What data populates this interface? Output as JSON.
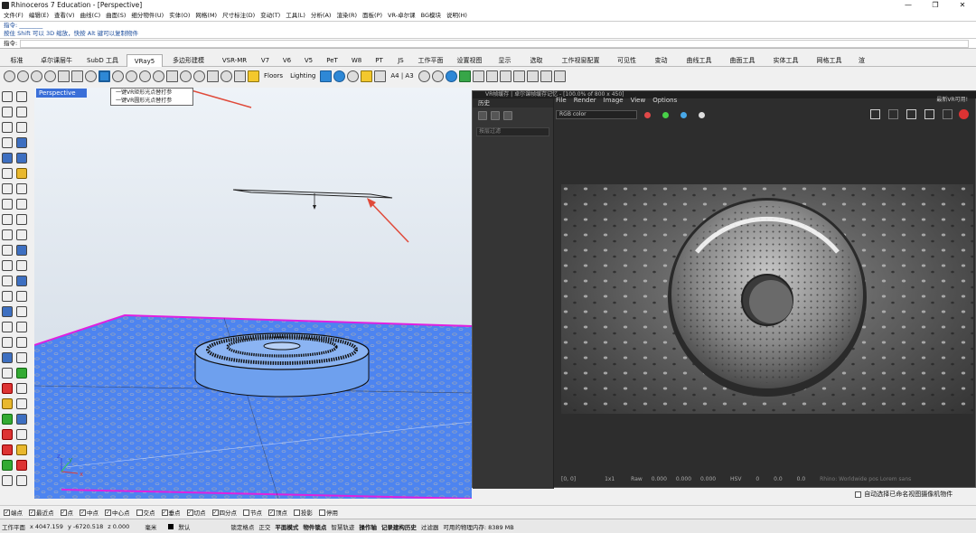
{
  "app": {
    "title": "Rhinoceros 7 Education - [Perspective]",
    "window_controls": [
      "—",
      "❐",
      "✕"
    ]
  },
  "menu": [
    "文件(F)",
    "编辑(E)",
    "查看(V)",
    "曲线(C)",
    "曲面(S)",
    "细分物件(U)",
    "实体(O)",
    "网格(M)",
    "尺寸标注(D)",
    "变动(T)",
    "工具(L)",
    "分析(A)",
    "渲染(R)",
    "面板(P)",
    "VR-卓尔课",
    "BG模块",
    "说明(H)"
  ],
  "command": {
    "history_line1": "指令: ________",
    "history_line2": "按住 Shift 可以 3D 缩放，快按 Alt 键可以复制物件",
    "prompt_label": "指令:",
    "value": ""
  },
  "tabs": [
    "标准",
    "卓尔课层牛",
    "SubD 工具",
    "VRay5",
    "多边形建模",
    "VSR-MR",
    "V7",
    "V6",
    "V5",
    "PeT",
    "W8",
    "PT",
    "JS",
    "工作平面",
    "设置视图",
    "显示",
    "选取",
    "工作视窗配置",
    "可见性",
    "变动",
    "曲线工具",
    "曲面工具",
    "实体工具",
    "网格工具",
    "渲"
  ],
  "active_tab": "VRay5",
  "toolbar": {
    "floors_label": "Floors",
    "lighting_label": "Lighting",
    "paper_label": "A4 | A3"
  },
  "viewport": {
    "label": "Perspective",
    "popup_items": [
      "一键VR矩形光点替打参",
      "一键VR圆形光点替打参"
    ],
    "axis_x": "x",
    "axis_y": "y",
    "axis_z": "z"
  },
  "vr_window": {
    "title": "VR帧缓存 | 卓尔课帧缓存记忆 - [100.0% of 800 x 450]",
    "menu": [
      "File",
      "Render",
      "Image",
      "View",
      "Options"
    ],
    "right_note": "最新VR可用!",
    "history_tab": "历史",
    "filter_placeholder": "按层过滤",
    "channel": "RGB color",
    "status_coords": "[0, 0]",
    "status_mode": "1x1",
    "status_raw": "Raw",
    "status_values": [
      "0.000",
      "0.000",
      "0.000"
    ],
    "status_hsv": "HSV",
    "status_hsv_values": [
      "0",
      "0.0",
      "0.0"
    ],
    "status_right": "Rhino: Worldwide pos Lorem sans"
  },
  "auto_checkbox_label": "自动选择已命名视图摄像机物件",
  "snaps": [
    "端点",
    "最近点",
    "点",
    "中点",
    "中心点",
    "交点",
    "垂点",
    "切点",
    "四分点",
    "节点",
    "顶点",
    "投影",
    "停用"
  ],
  "snaps_checked": [
    true,
    true,
    true,
    true,
    true,
    false,
    true,
    true,
    true,
    false,
    true,
    false,
    false
  ],
  "status": {
    "plane": "工作平面",
    "x": "x 4047.159",
    "y": "y -6720.518",
    "z": "z 0.000",
    "unit": "毫米",
    "layer": "默认",
    "items": [
      "锁定格点",
      "正交",
      "平面模式",
      "物件锁点",
      "智慧轨迹",
      "操作轴",
      "记录建构历史",
      "过滤器"
    ],
    "bold_items": [
      false,
      false,
      true,
      true,
      false,
      true,
      true,
      false
    ],
    "memory": "可用的物理内存: 8389 MB"
  },
  "colors": {
    "accent": "#3a6fd8",
    "arrow": "#e04a3a",
    "ground": "#4d84f0",
    "border_magenta": "#e020e0"
  }
}
